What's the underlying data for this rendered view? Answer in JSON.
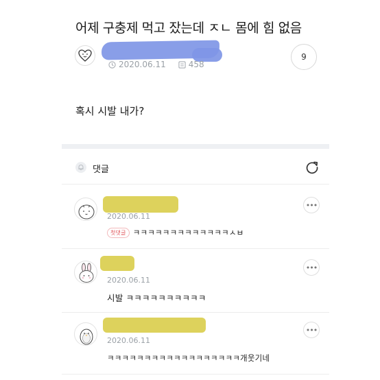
{
  "post": {
    "title": "어제 구충제 먹고 잤는데 ㅈㄴ 몸에 힘 없음",
    "date": "2020.06.11",
    "views": "458",
    "comment_count": "9",
    "body": "혹시 시발 내가?"
  },
  "comments_section": {
    "label": "댓글"
  },
  "comments": [
    {
      "date": "2020.06.11",
      "badge": "첫댓글",
      "text": "ㅋㅋㅋㅋㅋㅋㅋㅋㅋㅋㅋㅋㅋㅅㅂ",
      "more": "•••"
    },
    {
      "date": "2020.06.11",
      "text": "시발 ㅋㅋㅋㅋㅋㅋㅋㅋㅋㅋ",
      "more": "•••"
    },
    {
      "date": "2020.06.11",
      "text": "ㅋㅋㅋㅋㅋㅋㅋㅋㅋㅋㅋㅋㅋㅋㅋㅋㅋㅋ개웃기네",
      "more": "•••"
    }
  ],
  "colors": {
    "redaction_author": "#7f96e6",
    "redaction_commenters": "#d9cd4a",
    "badge": "#e0565b"
  }
}
